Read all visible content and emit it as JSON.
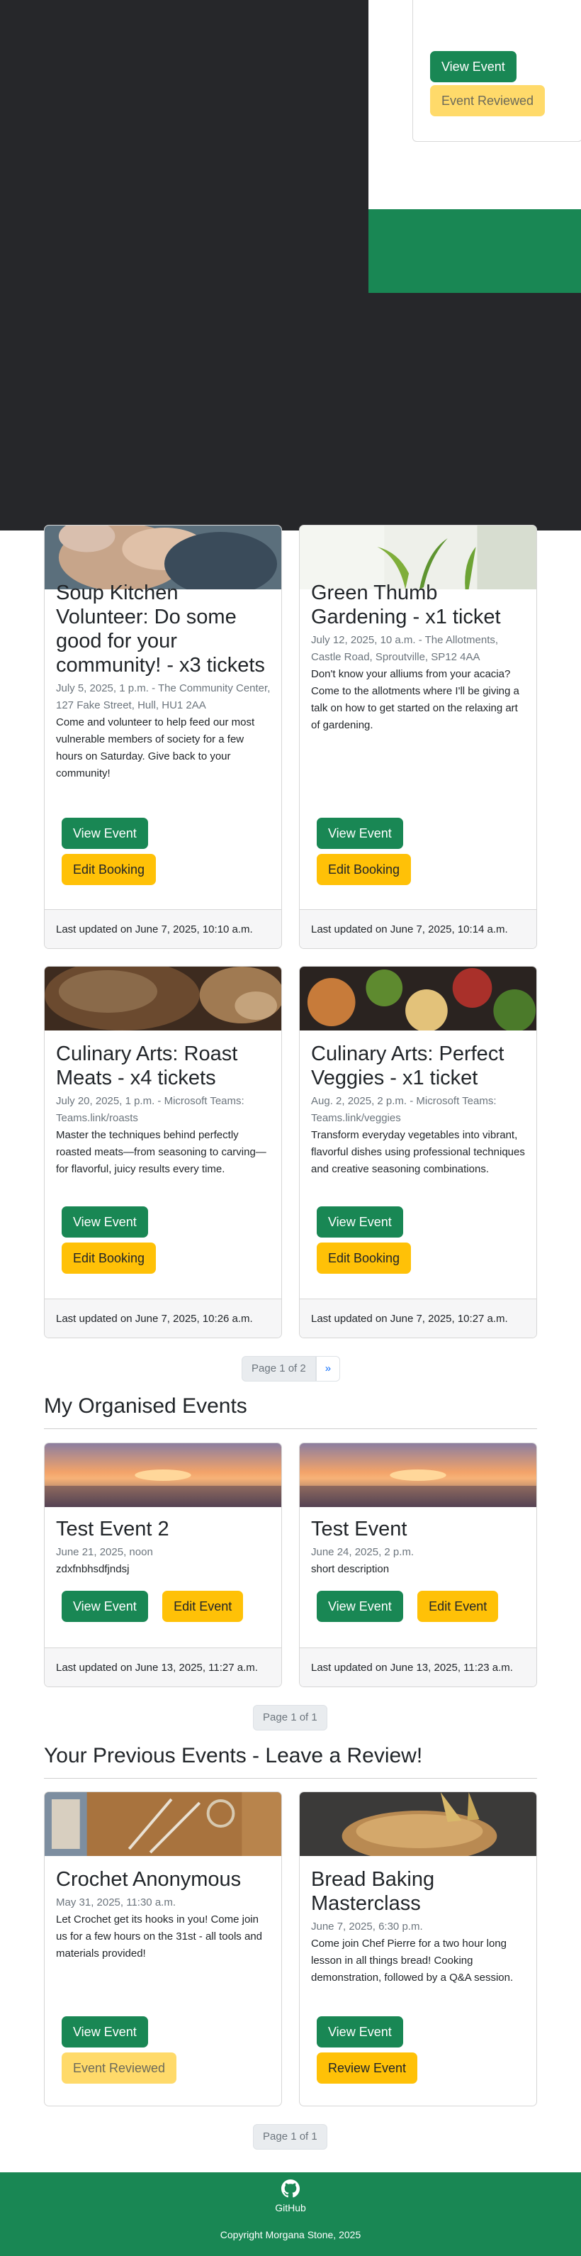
{
  "overlay_card": {
    "view_label": "View Event",
    "status_label": "Event Reviewed"
  },
  "bookings": [
    {
      "title": "Soup Kitchen Volunteer: Do some good for your community! - x3 tickets",
      "meta": "July 5, 2025, 1 p.m. - The Community Center, 127 Fake Street, Hull, HU1 2AA",
      "description": "Come and volunteer to help feed our most vulnerable members of society for a few hours on Saturday. Give back to your community!",
      "view_label": "View Event",
      "edit_label": "Edit Booking",
      "updated": "Last updated on June 7, 2025, 10:10 a.m.",
      "image": "family-hands-photo"
    },
    {
      "title": "Green Thumb Gardening - x1 ticket",
      "meta": "July 12, 2025, 10 a.m. - The Allotments, Castle Road, Sproutville, SP12 4AA",
      "description": "Don't know your alliums from your acacia? Come to the allotments where I'll be giving a talk on how to get started on the relaxing art of gardening.",
      "view_label": "View Event",
      "edit_label": "Edit Booking",
      "updated": "Last updated on June 7, 2025, 10:14 a.m.",
      "image": "seedlings-photo"
    },
    {
      "title": "Culinary Arts: Roast Meats - x4 tickets",
      "meta": "July 20, 2025, 1 p.m. - Microsoft Teams: Teams.link/roasts",
      "description": "Master the techniques behind perfectly roasted meats—from seasoning to carving—for flavorful, juicy results every time.",
      "view_label": "View Event",
      "edit_label": "Edit Booking",
      "updated": "Last updated on June 7, 2025, 10:26 a.m.",
      "image": "roast-meat-photo"
    },
    {
      "title": "Culinary Arts: Perfect Veggies - x1 ticket",
      "meta": "Aug. 2, 2025, 2 p.m. - Microsoft Teams: Teams.link/veggies",
      "description": "Transform everyday vegetables into vibrant, flavorful dishes using professional techniques and creative seasoning combinations.",
      "view_label": "View Event",
      "edit_label": "Edit Booking",
      "updated": "Last updated on June 7, 2025, 10:27 a.m.",
      "image": "vegetable-bowls-photo"
    }
  ],
  "bookings_pager": {
    "page_label": "Page 1 of 2",
    "next_label": "»"
  },
  "organised": {
    "heading": "My Organised Events",
    "events": [
      {
        "title": "Test Event 2",
        "meta": "June 21, 2025, noon",
        "description": "zdxfnbhsdfjndsj",
        "view_label": "View Event",
        "edit_label": "Edit Event",
        "updated": "Last updated on June 13, 2025, 11:27 a.m.",
        "image": "sunset-sea-photo"
      },
      {
        "title": "Test Event",
        "meta": "June 24, 2025, 2 p.m.",
        "description": "short description",
        "view_label": "View Event",
        "edit_label": "Edit Event",
        "updated": "Last updated on June 13, 2025, 11:23 a.m.",
        "image": "sunset-sea-photo"
      }
    ],
    "pager_label": "Page 1 of 1"
  },
  "previous": {
    "heading": "Your Previous Events - Leave a Review!",
    "events": [
      {
        "title": "Crochet Anonymous",
        "meta": "May 31, 2025, 11:30 a.m.",
        "description": "Let Crochet get its hooks in you! Come join us for a few hours on the 31st - all tools and materials provided!",
        "view_label": "View Event",
        "status_label": "Event Reviewed",
        "image": "crafting-tools-photo"
      },
      {
        "title": "Bread Baking Masterclass",
        "meta": "June 7, 2025, 6:30 p.m.",
        "description": "Come join Chef Pierre for a two hour long lesson in all things bread! Cooking demonstration, followed by a Q&A session.",
        "view_label": "View Event",
        "review_label": "Review Event",
        "image": "bread-loaf-photo"
      }
    ],
    "pager_label": "Page 1 of 1"
  },
  "footer": {
    "github_label": "GitHub",
    "copyright": "Copyright Morgana Stone, 2025",
    "icon": "github-icon"
  },
  "colors": {
    "primary_green": "#198754",
    "warning_yellow": "#ffc107",
    "overlay_dark": "#26272a"
  }
}
